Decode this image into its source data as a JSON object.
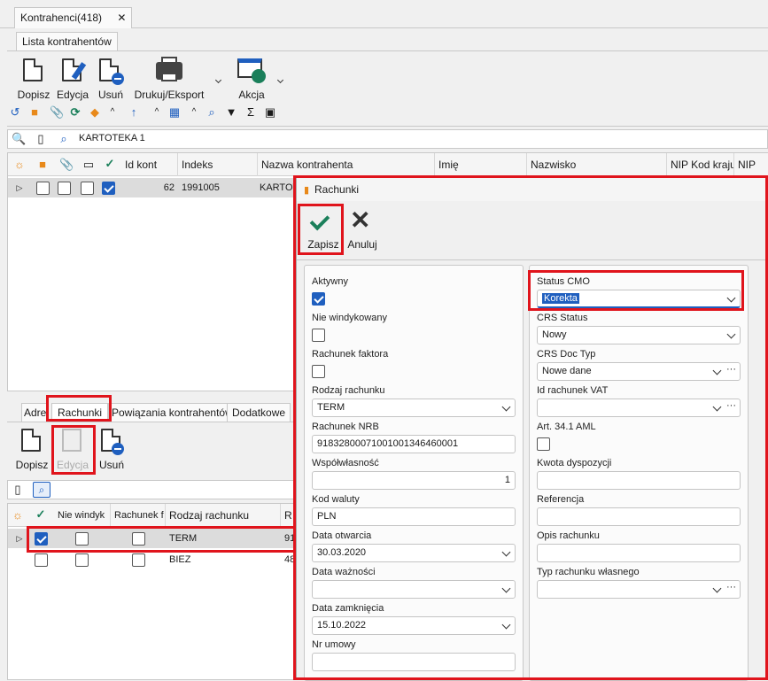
{
  "window_tab": "Kontrahenci(418)",
  "subtab": "Lista kontrahentów",
  "toolbar": {
    "dopisz": "Dopisz",
    "edycja": "Edycja",
    "usun": "Usuń",
    "drukuj": "Drukuj/Eksport",
    "akcja": "Akcja"
  },
  "search": {
    "value": "KARTOTEKA 1"
  },
  "grid": {
    "headers": [
      "Id kont",
      "Indeks",
      "Nazwa kontrahenta",
      "Imię",
      "Nazwisko",
      "NIP Kod kraju",
      "NIP"
    ],
    "row": {
      "id": "62",
      "indeks": "1991005",
      "nazwa": "KARTOT"
    }
  },
  "bottom_tabs": [
    "Adre",
    "Rachunki",
    "Powiązania kontrahentów",
    "Dodatkowe"
  ],
  "bottom_toolbar": {
    "dopisz": "Dopisz",
    "edycja": "Edycja",
    "usun": "Usuń"
  },
  "bottom_grid": {
    "headers": [
      "Nie windyk",
      "Rachunek f",
      "Rodzaj rachunku",
      "R"
    ],
    "rows": [
      {
        "rodzaj": "TERM",
        "r": "91",
        "checked": true
      },
      {
        "rodzaj": "BIEZ",
        "r": "48",
        "checked": false
      }
    ]
  },
  "dialog": {
    "title": "Rachunki",
    "zapisz": "Zapisz",
    "anuluj": "Anuluj",
    "left": {
      "aktywny_label": "Aktywny",
      "nie_windykowany_label": "Nie windykowany",
      "rachunek_faktora_label": "Rachunek faktora",
      "rodzaj_label": "Rodzaj rachunku",
      "rodzaj_value": "TERM",
      "nrb_label": "Rachunek NRB",
      "nrb_value": "91832800071001001346460001",
      "wspolwlasnosc_label": "Współwłasność",
      "wspolwlasnosc_value": "1",
      "kod_waluty_label": "Kod waluty",
      "kod_waluty_value": "PLN",
      "data_otwarcia_label": "Data otwarcia",
      "data_otwarcia_value": "30.03.2020",
      "data_waznosci_label": "Data ważności",
      "data_waznosci_value": "",
      "data_zamkniecia_label": "Data zamknięcia",
      "data_zamkniecia_value": "15.10.2022",
      "nr_umowy_label": "Nr umowy",
      "nr_umowy_value": ""
    },
    "right": {
      "status_cmo_label": "Status CMO",
      "status_cmo_value": "Korekta",
      "crs_status_label": "CRS Status",
      "crs_status_value": "Nowy",
      "crs_doc_label": "CRS Doc Typ",
      "crs_doc_value": "Nowe dane",
      "id_vat_label": "Id rachunek VAT",
      "id_vat_value": "",
      "art_label": "Art. 34.1 AML",
      "kwota_label": "Kwota dyspozycji",
      "kwota_value": "",
      "referencja_label": "Referencja",
      "referencja_value": "",
      "opis_label": "Opis rachunku",
      "opis_value": "",
      "typ_label": "Typ rachunku własnego",
      "typ_value": ""
    }
  },
  "colors": {
    "accent": "#1f5fbf",
    "highlight": "#e0141c",
    "green_check": "#1a7f5a"
  }
}
